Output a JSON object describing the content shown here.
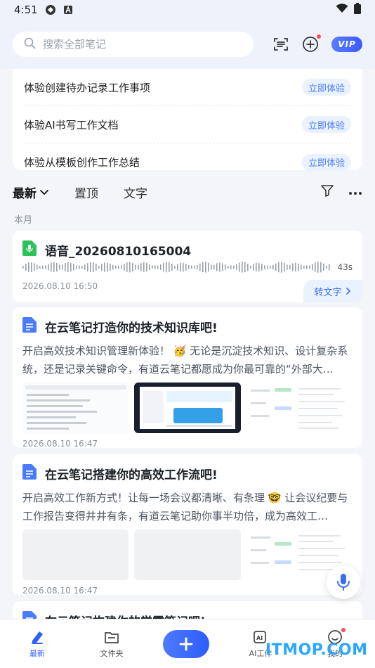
{
  "status_bar": {
    "time": "4:51"
  },
  "header": {
    "search_placeholder": "搜索全部笔记",
    "vip_label": "VIP"
  },
  "experience": {
    "items": [
      {
        "label": "体验创建待办记录工作事项",
        "button": "立即体验"
      },
      {
        "label": "体验AI书写工作文档",
        "button": "立即体验"
      },
      {
        "label": "体验从模板创作工作总结",
        "button": "立即体验"
      }
    ]
  },
  "tabs": {
    "items": [
      "最新",
      "置顶",
      "文字"
    ]
  },
  "section": {
    "month_label": "本月"
  },
  "notes": [
    {
      "title": "语音_20260810165004",
      "duration": "43s",
      "date": "2026.08.10 16:50",
      "action": "转文字"
    },
    {
      "title": "在云笔记打造你的技术知识库吧!",
      "snippet": "开启高效技术知识管理新体验！ 🥳 无论是沉淀技术知识、设计复杂系统，还是记录关键命令，有道云笔记都愿成为你最可靠的“外部大…",
      "date": "2026.08.10 16:47"
    },
    {
      "title": "在云笔记搭建你的高效工作流吧!",
      "snippet": "开启高效工作新方式！让每一场会议都清晰、有条理 🤓 让会议纪要与工作报告变得井井有条，有道云笔记助你事半功倍，成为高效工…",
      "date": "2026.08.10 16:47"
    },
    {
      "title": "在云笔记构建你的学霸笔记吧!"
    }
  ],
  "bottom_nav": {
    "latest": "最新",
    "folders": "文件夹",
    "ai": "AI工作",
    "me": "我的"
  },
  "watermark": "ITMOP.COM",
  "colors": {
    "accent": "#3b6cf5",
    "doc_icon": "#4a7bff",
    "voice_icon": "#2fc25b"
  }
}
